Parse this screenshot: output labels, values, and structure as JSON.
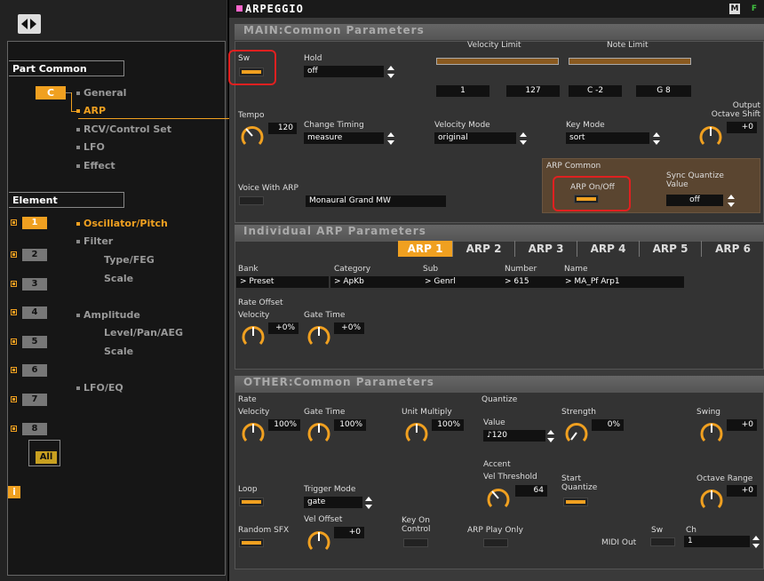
{
  "colors": {
    "accent": "#f0a020",
    "highlight": "#e02020",
    "title_bar": "#ff66cc"
  },
  "window": {
    "title": "ARPEGGIO",
    "corner_icons": [
      "M",
      "F"
    ]
  },
  "sidebar": {
    "part_common_header": "Part Common",
    "part_button": "C",
    "part_items": [
      {
        "label": "General",
        "active": false
      },
      {
        "label": "ARP",
        "active": true
      },
      {
        "label": "RCV/Control Set",
        "active": false
      },
      {
        "label": "LFO",
        "active": false
      },
      {
        "label": "Effect",
        "active": false
      }
    ],
    "element_header": "Element",
    "elements": [
      "1",
      "2",
      "3",
      "4",
      "5",
      "6",
      "7",
      "8"
    ],
    "all_button": "All",
    "element_items": [
      {
        "label": "Oscillator/Pitch",
        "active": true
      },
      {
        "label": "Filter",
        "active": false
      },
      {
        "label": "Type/FEG",
        "active": false
      },
      {
        "label": "Scale",
        "active": false
      },
      {
        "label": "Amplitude",
        "active": false
      },
      {
        "label": "Level/Pan/AEG",
        "active": false
      },
      {
        "label": "Scale",
        "active": false
      },
      {
        "label": "LFO/EQ",
        "active": false
      }
    ],
    "info_icon": "i"
  },
  "main_common": {
    "section_title": "MAIN:Common Parameters",
    "sw_label": "Sw",
    "hold_label": "Hold",
    "hold_value": "off",
    "velocity_limit_label": "Velocity Limit",
    "velocity_low": "1",
    "velocity_high": "127",
    "note_limit_label": "Note Limit",
    "note_low": "C -2",
    "note_high": "G 8",
    "tempo_label": "Tempo",
    "tempo_value": "120",
    "change_timing_label": "Change Timing",
    "change_timing_value": "measure",
    "velocity_mode_label": "Velocity Mode",
    "velocity_mode_value": "original",
    "key_mode_label": "Key Mode",
    "key_mode_value": "sort",
    "output_octave_label_1": "Output",
    "output_octave_label_2": "Octave Shift",
    "output_octave_value": "+0",
    "voice_with_arp_label": "Voice With ARP",
    "voice_with_arp_value": "Monaural Grand MW",
    "arp_common_label": "ARP Common",
    "arp_onoff_label": "ARP On/Off",
    "sync_quantize_label_1": "Sync Quantize",
    "sync_quantize_label_2": "Value",
    "sync_quantize_value": "off"
  },
  "individual": {
    "section_title": "Individual ARP Parameters",
    "tabs": [
      "ARP 1",
      "ARP 2",
      "ARP 3",
      "ARP 4",
      "ARP 5",
      "ARP 6"
    ],
    "active_tab": 0,
    "bank_label": "Bank",
    "bank_value": "> Preset",
    "category_label": "Category",
    "category_value": "> ApKb",
    "sub_label": "Sub",
    "sub_value": "> Genrl",
    "number_label": "Number",
    "number_value": "> 615",
    "name_label": "Name",
    "name_value": "> MA_Pf Arp1",
    "rate_offset_label": "Rate Offset",
    "velocity_label": "Velocity",
    "velocity_value": "+0%",
    "gate_time_label": "Gate Time",
    "gate_time_value": "+0%"
  },
  "other": {
    "section_title": "OTHER:Common Parameters",
    "rate_label": "Rate",
    "velocity_label": "Velocity",
    "velocity_value": "100%",
    "gate_time_label": "Gate Time",
    "gate_time_value": "100%",
    "unit_multiply_label": "Unit Multiply",
    "unit_multiply_value": "100%",
    "quantize_label": "Quantize",
    "value_label": "Value",
    "value_value": "♪120",
    "strength_label": "Strength",
    "strength_value": "0%",
    "swing_label": "Swing",
    "swing_value": "+0",
    "accent_label": "Accent",
    "vel_threshold_label": "Vel Threshold",
    "vel_threshold_value": "64",
    "start_quantize_label_1": "Start",
    "start_quantize_label_2": "Quantize",
    "loop_label": "Loop",
    "trigger_mode_label": "Trigger Mode",
    "trigger_mode_value": "gate",
    "octave_range_label": "Octave Range",
    "octave_range_value": "+0",
    "random_sfx_label": "Random SFX",
    "vel_offset_label": "Vel Offset",
    "vel_offset_value": "+0",
    "key_on_control_label_1": "Key On",
    "key_on_control_label_2": "Control",
    "arp_play_only_label": "ARP Play Only",
    "midi_out_label": "MIDI Out",
    "sw_label": "Sw",
    "ch_label": "Ch",
    "ch_value": "1"
  }
}
